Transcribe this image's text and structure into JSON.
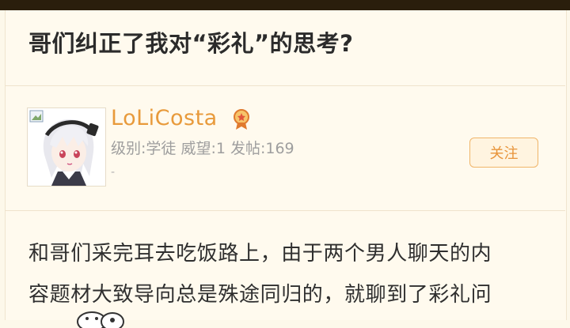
{
  "post": {
    "title": "哥们纠正了我对“彩礼”的思考?"
  },
  "author": {
    "username": "LoLiCosta",
    "stats": "级别:学徒 威望:1 发帖:169",
    "extra": "-",
    "follow_label": "关注",
    "avatar_icon": "anime-avatar",
    "badge_icon": "rank-badge-icon"
  },
  "content": {
    "lines": [
      "和哥们采完耳去吃饭路上，由于两个男人聊天的内",
      "容题材大致导向总是殊途同归的，就聊到了彩礼问"
    ]
  },
  "colors": {
    "accent": "#e89a3b",
    "background": "#fffaee"
  }
}
